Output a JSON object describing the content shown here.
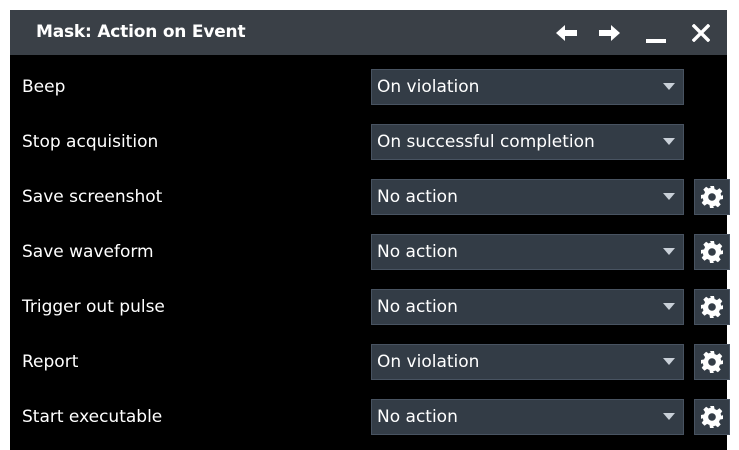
{
  "dialog": {
    "title": "Mask: Action on Event",
    "controls": {
      "back_icon": "arrow-left-icon",
      "forward_icon": "arrow-right-icon",
      "minimize_icon": "minimize-icon",
      "close_icon": "close-icon"
    }
  },
  "rows": [
    {
      "label": "Beep",
      "value": "On violation",
      "has_settings": false
    },
    {
      "label": "Stop acquisition",
      "value": "On successful completion",
      "has_settings": false
    },
    {
      "label": "Save screenshot",
      "value": "No action",
      "has_settings": true
    },
    {
      "label": "Save waveform",
      "value": "No action",
      "has_settings": true
    },
    {
      "label": "Trigger out pulse",
      "value": "No action",
      "has_settings": true
    },
    {
      "label": "Report",
      "value": "On violation",
      "has_settings": true
    },
    {
      "label": "Start executable",
      "value": "No action",
      "has_settings": true
    }
  ],
  "colors": {
    "titlebar": "#3a4047",
    "background": "#000000",
    "field": "#333c46",
    "field_border": "#485361",
    "text": "#ffffff"
  }
}
